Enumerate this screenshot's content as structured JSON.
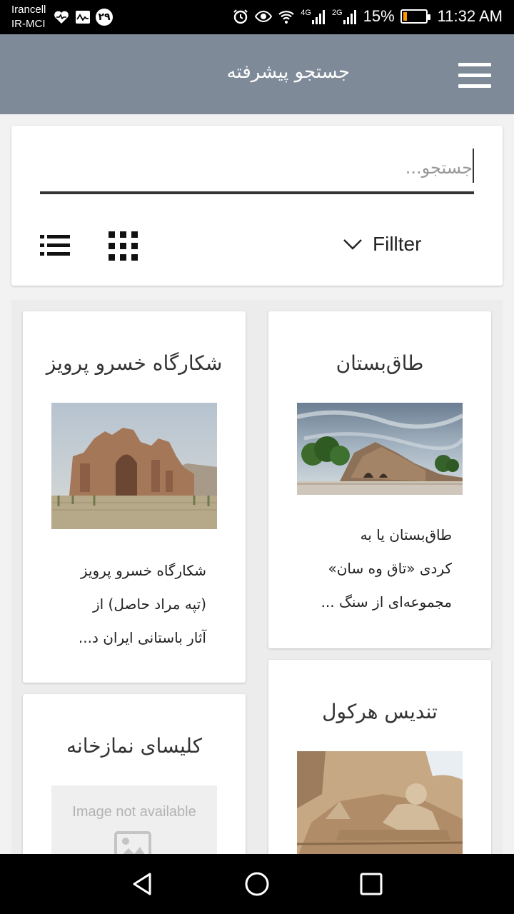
{
  "status_bar": {
    "carrier_line1": "Irancell",
    "carrier_line2": "IR-MCI",
    "notification_badge": "۲۹",
    "signal_4g": "4G",
    "signal_2g": "2G",
    "battery_percent": "15%",
    "battery_level": 0.15,
    "time": "11:32 AM"
  },
  "appbar": {
    "title": "جستجو پیشرفته",
    "menu_icon": "hamburger-menu-icon",
    "background": "#7f8a99"
  },
  "search": {
    "placeholder": "جستجو...",
    "value": "",
    "filter_label": "Fillter"
  },
  "cards": [
    {
      "title": "طاق‌بستان",
      "description": [
        "طاق‌بستان یا به",
        "کردی «تاق وه سان»",
        "مجموعه‌ای از سنگ ..."
      ]
    },
    {
      "title": "شکارگاه خسرو پرویز",
      "description": [
        "شکارگاه خسرو پرویز",
        "(تپه مراد حاصل) از",
        "آثار باستانی ایران د..."
      ]
    },
    {
      "title": "تندیس هرکول",
      "description": []
    },
    {
      "title": "کلیسای نمازخانه",
      "image_placeholder_text": "Image not available",
      "description": []
    }
  ]
}
